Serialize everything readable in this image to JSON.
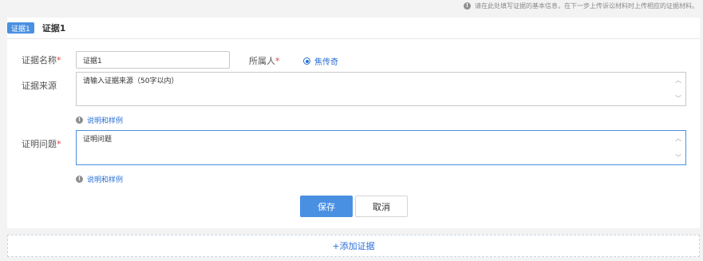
{
  "notice": {
    "text": "请在此处填写证据的基本信息，在下一步上传诉讼材料时上传相应的证据材料。"
  },
  "evidence": {
    "tag": "证据1",
    "title": "证据1",
    "name_label": "证据名称",
    "name_value": "证据1",
    "owner_label": "所属人",
    "owner_option": "焦传奇",
    "source_label": "证据来源",
    "source_placeholder": "请输入证据来源（50字以内）",
    "issue_label": "证明问题",
    "issue_value": "证明问题",
    "hint_text": "说明和样例",
    "required_mark": "*"
  },
  "actions": {
    "save": "保存",
    "cancel": "取消"
  },
  "add_evidence": "+添加证据",
  "colors": {
    "accent": "#4a90e2",
    "link": "#2a6fd6",
    "required": "#e04040"
  },
  "icons": {
    "info": "info-icon",
    "scroll_up": "chevron-up-icon",
    "scroll_down": "chevron-down-icon"
  }
}
